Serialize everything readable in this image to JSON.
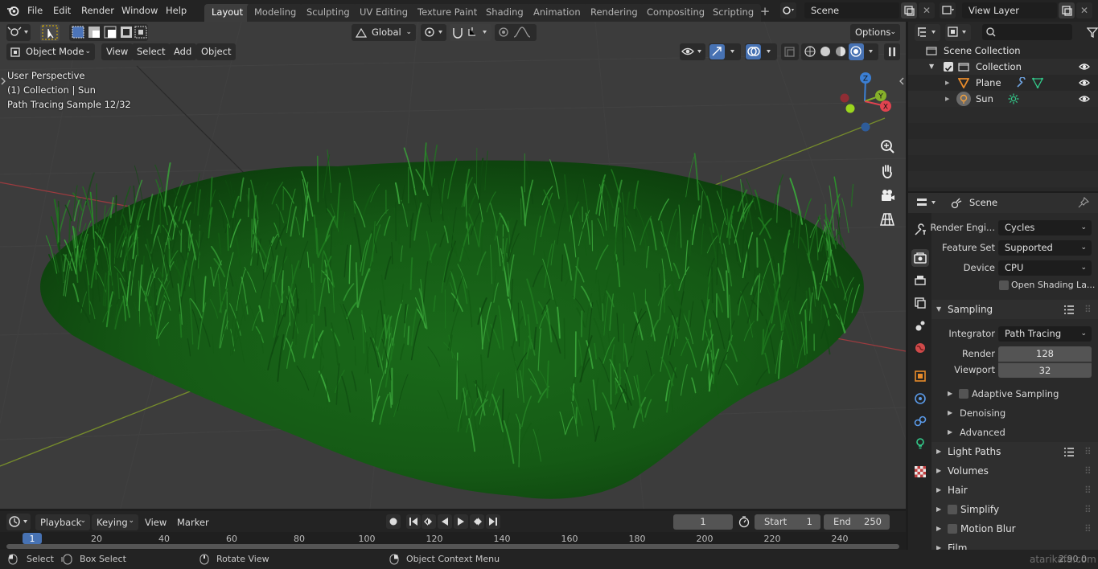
{
  "menubar": {
    "items": [
      "File",
      "Edit",
      "Render",
      "Window",
      "Help"
    ]
  },
  "workspaces": [
    "Layout",
    "Modeling",
    "Sculpting",
    "UV Editing",
    "Texture Paint",
    "Shading",
    "Animation",
    "Rendering",
    "Compositing",
    "Scripting"
  ],
  "scene_field": "Scene",
  "view_layer_field": "View Layer",
  "tool_header": {
    "orientation": "Global",
    "options": "Options"
  },
  "viewport_header": {
    "mode": "Object Mode",
    "menus": [
      "View",
      "Select",
      "Add",
      "Object"
    ]
  },
  "viewport_overlay": {
    "line1": "User Perspective",
    "line2": "(1) Collection | Sun",
    "line3": "Path Tracing Sample 12/32"
  },
  "gizmo": {
    "z": "Z",
    "y": "Y",
    "x": "X"
  },
  "timeline": {
    "menus": [
      "Playback",
      "Keying",
      "View",
      "Marker"
    ],
    "current_frame": "1",
    "start_label": "Start",
    "start_value": "1",
    "end_label": "End",
    "end_value": "250",
    "ruler": [
      "1",
      "20",
      "40",
      "60",
      "80",
      "100",
      "120",
      "140",
      "160",
      "180",
      "200",
      "220",
      "240"
    ]
  },
  "statusbar": {
    "select": "Select",
    "box_select": "Box Select",
    "rotate_view": "Rotate View",
    "context_menu": "Object Context Menu",
    "version": "2.90.0",
    "watermark": "atarikafa.com"
  },
  "outliner": {
    "rows": [
      "Scene Collection",
      "Collection",
      "Plane",
      "Sun"
    ]
  },
  "properties": {
    "context": "Scene",
    "render_engine_label": "Render Engi...",
    "render_engine": "Cycles",
    "feature_set_label": "Feature Set",
    "feature_set": "Supported",
    "device_label": "Device",
    "device": "CPU",
    "osl_label": "Open Shading La...",
    "sampling": "Sampling",
    "integrator_label": "Integrator",
    "integrator": "Path Tracing",
    "render_label": "Render",
    "render_samples": "128",
    "viewport_label": "Viewport",
    "viewport_samples": "32",
    "adaptive": "Adaptive Sampling",
    "denoising": "Denoising",
    "advanced": "Advanced",
    "light_paths": "Light Paths",
    "volumes": "Volumes",
    "hair": "Hair",
    "simplify": "Simplify",
    "motion_blur": "Motion Blur",
    "film": "Film"
  },
  "colors": {
    "grass_dark": "#0f4a10",
    "grass_mid": "#1f7a1f",
    "grass_light": "#3aa53a",
    "axis_x": "#b3393f",
    "axis_y": "#7c9a2a",
    "active_tab": "#3d3d3d"
  }
}
